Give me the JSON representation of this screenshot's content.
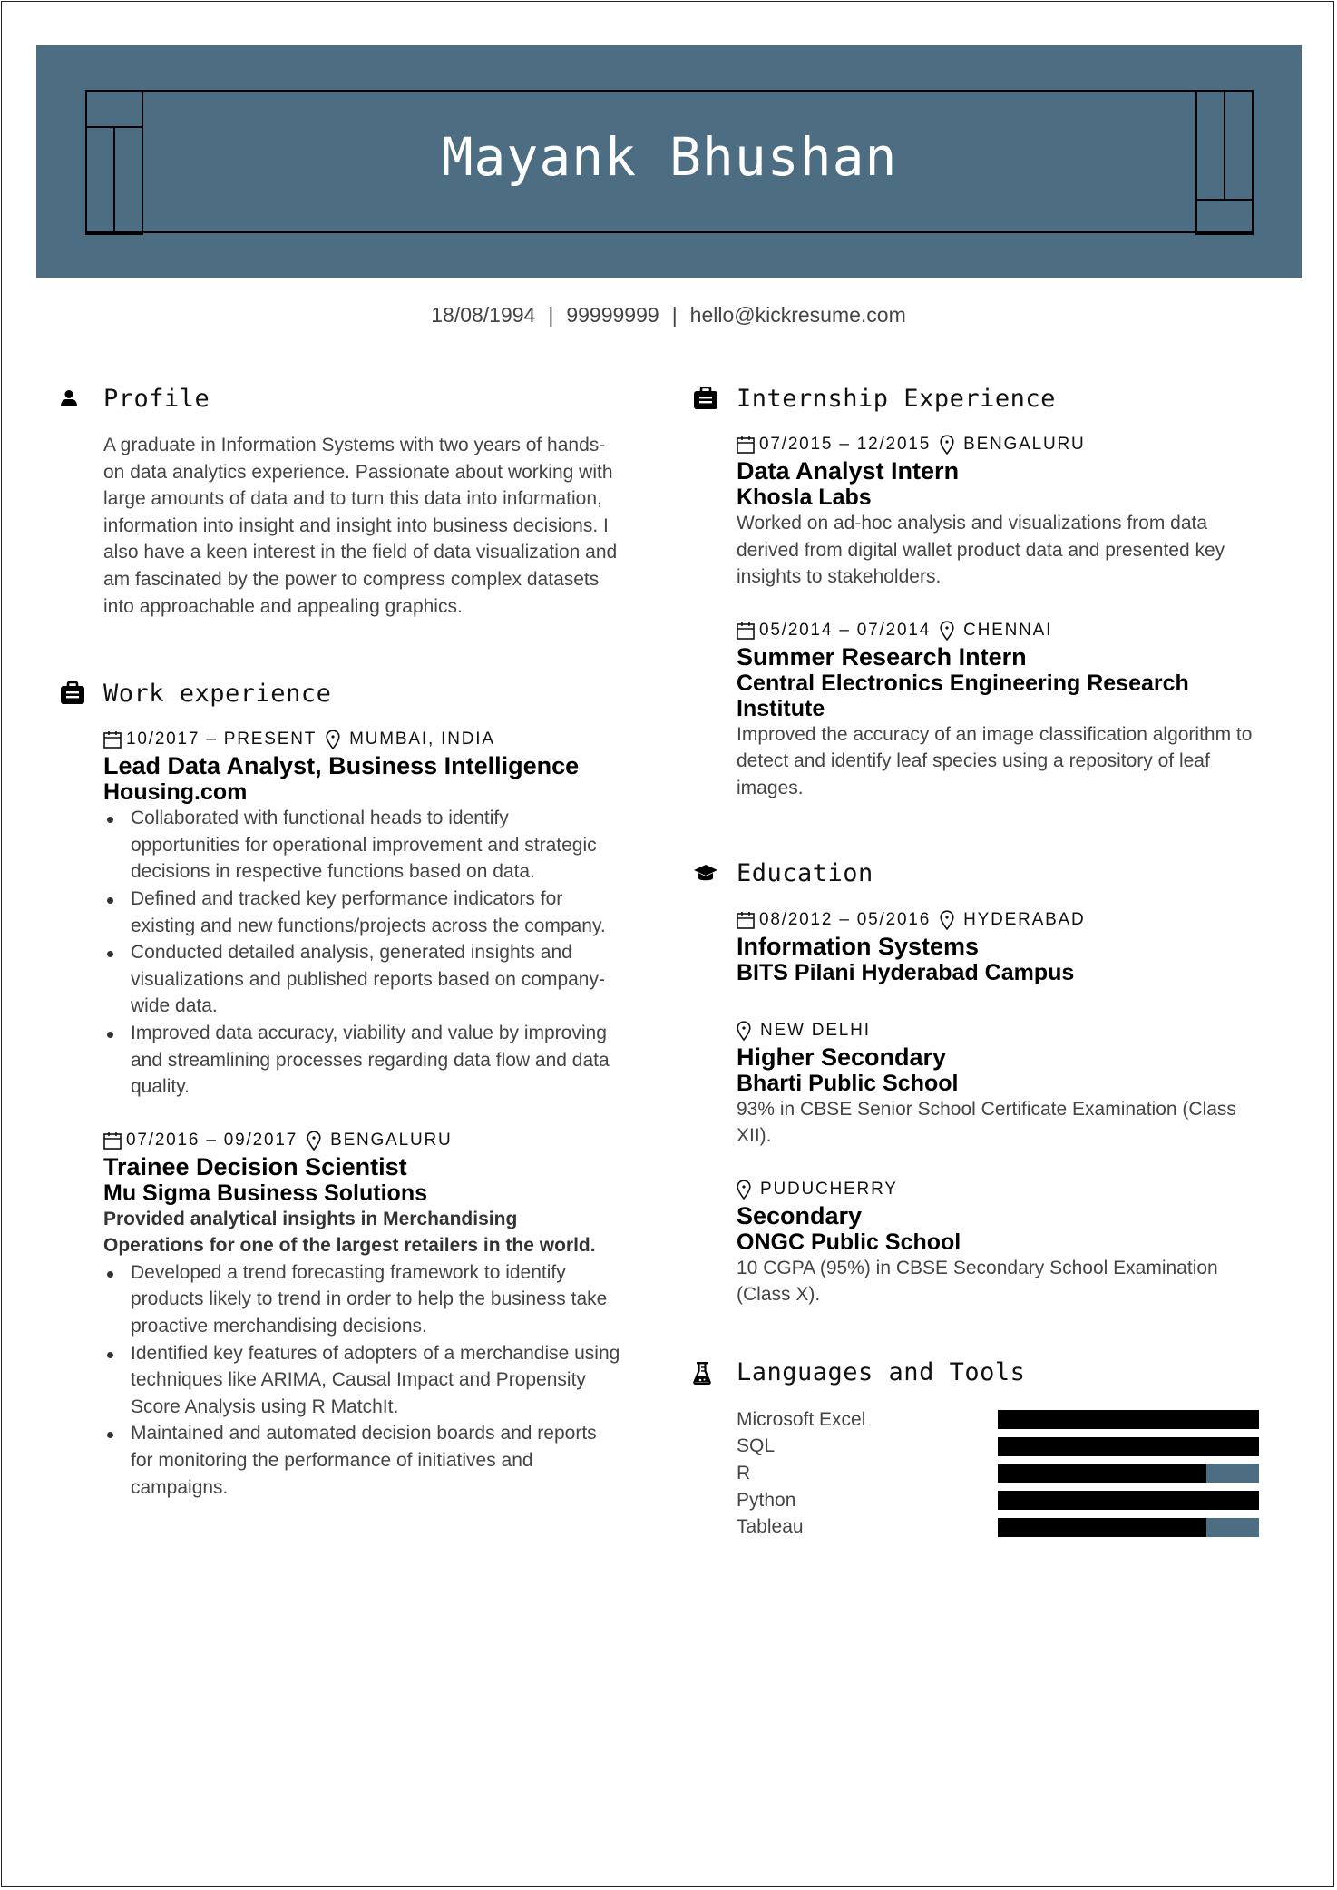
{
  "header": {
    "name": "Mayank Bhushan",
    "brand_color": "#4d6d82"
  },
  "contact": {
    "dob": "18/08/1994",
    "phone": "99999999",
    "email": "hello@kickresume.com",
    "separator": "|"
  },
  "profile": {
    "title": "Profile",
    "icon": "user-icon",
    "text": "A graduate in Information Systems with two years of hands-on data analytics experience. Passionate about working with large amounts of data and to turn this data into information, information into insight and insight into business decisions. I also have a keen interest in the field of data visualization and am fascinated by the power to compress complex datasets into approachable and appealing graphics."
  },
  "work": {
    "title": "Work experience",
    "icon": "briefcase-icon",
    "entries": [
      {
        "dates": "10/2017 – PRESENT",
        "location": "MUMBAI, INDIA",
        "title": "Lead Data Analyst, Business Intelligence",
        "company": "Housing.com",
        "bullets": [
          "Collaborated with functional heads to identify opportunities for operational improvement and strategic decisions in respective functions based on data.",
          "Defined and tracked key performance indicators for existing and new functions/projects across the company.",
          "Conducted detailed analysis, generated insights and visualizations and published reports based on company-wide data.",
          "Improved data accuracy, viability and value by improving and streamlining processes regarding data flow and data quality."
        ]
      },
      {
        "dates": "07/2016 – 09/2017",
        "location": "BENGALURU",
        "title": "Trainee Decision Scientist",
        "company": "Mu Sigma Business Solutions",
        "lead": "Provided analytical insights in Merchandising Operations for one of the largest retailers in the world.",
        "bullets": [
          "Developed a trend forecasting framework to identify products likely to trend in order to help the business take proactive merchandising decisions.",
          "Identified key features of adopters of a merchandise using techniques like ARIMA, Causal Impact and Propensity Score Analysis using R MatchIt.",
          "Maintained and automated decision boards and reports for monitoring the performance of initiatives and campaigns."
        ]
      }
    ]
  },
  "internship": {
    "title": "Internship Experience",
    "icon": "briefcase-icon",
    "entries": [
      {
        "dates": "07/2015 – 12/2015",
        "location": "BENGALURU",
        "title": "Data Analyst Intern",
        "company": "Khosla Labs",
        "description": "Worked on ad-hoc analysis and visualizations from data derived from digital wallet product data and presented key insights to stakeholders."
      },
      {
        "dates": "05/2014 – 07/2014",
        "location": "CHENNAI",
        "title": "Summer Research Intern",
        "company": "Central Electronics Engineering Research Institute",
        "description": "Improved the accuracy of an image classification algorithm to detect and identify leaf species using a repository of leaf images."
      }
    ]
  },
  "education": {
    "title": "Education",
    "icon": "graduation-cap-icon",
    "entries": [
      {
        "dates": "08/2012 – 05/2016",
        "location": "HYDERABAD",
        "degree": "Information Systems",
        "school": "BITS Pilani Hyderabad Campus"
      },
      {
        "location": "NEW DELHI",
        "degree": "Higher Secondary",
        "school": "Bharti Public School",
        "description": "93% in CBSE Senior School Certificate Examination (Class XII)."
      },
      {
        "location": "PUDUCHERRY",
        "degree": "Secondary",
        "school": "ONGC Public School",
        "description": "10 CGPA (95%) in CBSE Secondary School Examination (Class X)."
      }
    ]
  },
  "skills": {
    "title": "Languages and Tools",
    "icon": "flask-icon",
    "items": [
      {
        "name": "Microsoft Excel",
        "level": 1.0
      },
      {
        "name": "SQL",
        "level": 1.0
      },
      {
        "name": "R",
        "level": 0.8
      },
      {
        "name": "Python",
        "level": 1.0
      },
      {
        "name": "Tableau",
        "level": 0.8
      }
    ]
  }
}
